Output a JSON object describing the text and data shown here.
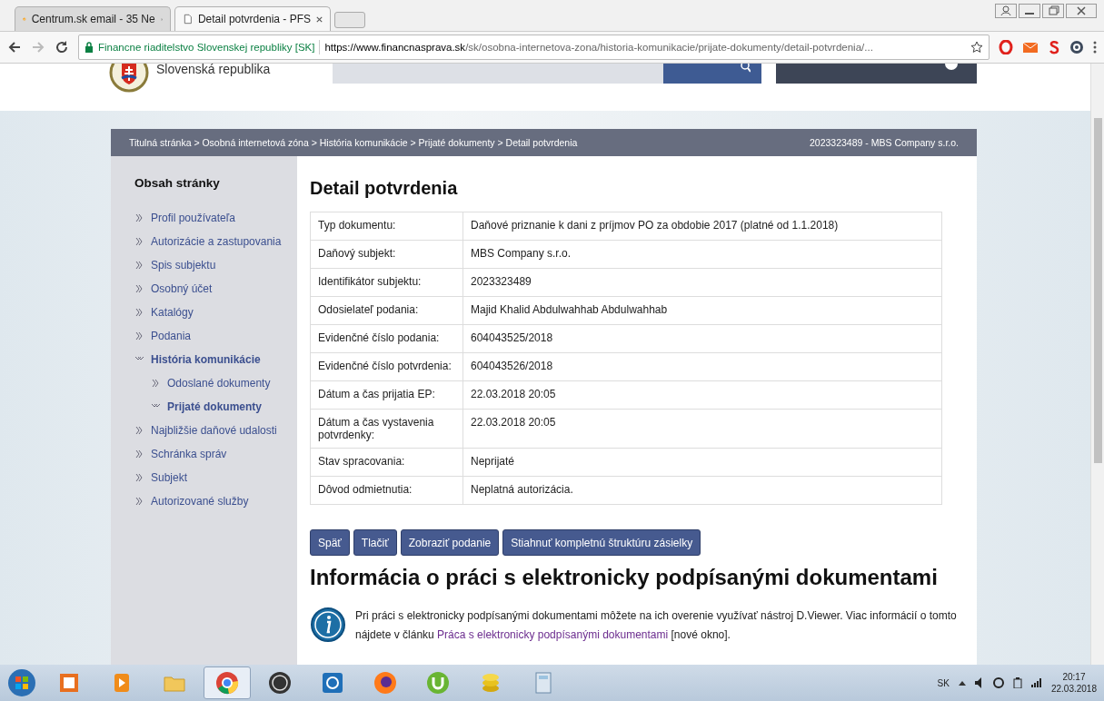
{
  "browser": {
    "tabs": [
      {
        "title": "Centrum.sk email - 35 Ne",
        "selected": false,
        "kind": "mail"
      },
      {
        "title": "Detail potvrdenia - PFS",
        "selected": true,
        "kind": "doc"
      }
    ],
    "security_label": "Financne riaditelstvo Slovenskej republiky [SK]",
    "url_host": "https://www.financnasprava.sk",
    "url_path": "/sk/osobna-internetova-zona/historia-komunikacie/prijate-dokumenty/detail-potvrdenia/..."
  },
  "header": {
    "site_name": "Slovenská republika"
  },
  "breadcrumb": {
    "items": [
      "Titulná stránka",
      "Osobná internetová zóna",
      "História komunikácie",
      "Prijaté dokumenty",
      "Detail potvrdenia"
    ],
    "separator": ">",
    "subject": "2023323489 - MBS Company s.r.o."
  },
  "sidebar": {
    "title": "Obsah stránky",
    "items": [
      {
        "label": "Profil používateľa",
        "expanded": false
      },
      {
        "label": "Autorizácie a zastupovania",
        "expanded": false
      },
      {
        "label": "Spis subjektu",
        "expanded": false
      },
      {
        "label": "Osobný účet",
        "expanded": false
      },
      {
        "label": "Katalógy",
        "expanded": false
      },
      {
        "label": "Podania",
        "expanded": false
      },
      {
        "label": "História komunikácie",
        "expanded": true,
        "children": [
          {
            "label": "Odoslané dokumenty",
            "expanded": false
          },
          {
            "label": "Prijaté dokumenty",
            "expanded": true
          }
        ]
      },
      {
        "label": "Najbližšie daňové udalosti",
        "expanded": false
      },
      {
        "label": "Schránka správ",
        "expanded": false
      },
      {
        "label": "Subjekt",
        "expanded": false
      },
      {
        "label": "Autorizované služby",
        "expanded": false
      }
    ]
  },
  "main": {
    "title": "Detail potvrdenia",
    "details": [
      {
        "label": "Typ dokumentu:",
        "value": "Daňové priznanie k dani z príjmov PO za obdobie 2017 (platné od 1.1.2018)"
      },
      {
        "label": "Daňový subjekt:",
        "value": "MBS Company s.r.o."
      },
      {
        "label": "Identifikátor subjektu:",
        "value": "2023323489"
      },
      {
        "label": "Odosielateľ podania:",
        "value": "Majid Khalid Abdulwahhab Abdulwahhab"
      },
      {
        "label": "Evidenčné číslo podania:",
        "value": "604043525/2018"
      },
      {
        "label": "Evidenčné číslo potvrdenia:",
        "value": "604043526/2018"
      },
      {
        "label": "Dátum a čas prijatia EP:",
        "value": "22.03.2018 20:05"
      },
      {
        "label": "Dátum a čas vystavenia potvrdenky:",
        "value": "22.03.2018 20:05"
      },
      {
        "label": "Stav spracovania:",
        "value": "Neprijaté"
      },
      {
        "label": "Dôvod odmietnutia:",
        "value": "Neplatná autorizácia."
      }
    ],
    "buttons": [
      "Späť",
      "Tlačiť",
      "Zobraziť podanie",
      "Stiahnuť kompletnú štruktúru zásielky"
    ],
    "info_title": "Informácia o práci s elektronicky podpísanými dokumentami",
    "info_text": "Pri práci s elektronicky podpísanými dokumentami môžete na ich overenie využívať nástroj D.Viewer. Viac informácií o tomto nájdete v článku",
    "info_link": "Práca s elektronicky podpísanými dokumentami",
    "info_suffix": "[nové okno]."
  },
  "taskbar": {
    "apps": [
      {
        "kind": "files",
        "selected": false
      },
      {
        "kind": "media",
        "selected": false
      },
      {
        "kind": "folder",
        "selected": false
      },
      {
        "kind": "chrome",
        "selected": true
      },
      {
        "kind": "hp",
        "selected": false
      },
      {
        "kind": "shield",
        "selected": false
      },
      {
        "kind": "firefox",
        "selected": false
      },
      {
        "kind": "torrent",
        "selected": false
      },
      {
        "kind": "coins",
        "selected": false
      },
      {
        "kind": "calculator",
        "selected": false
      }
    ],
    "language": "SK",
    "time": "20:17",
    "date": "22.03.2018"
  }
}
